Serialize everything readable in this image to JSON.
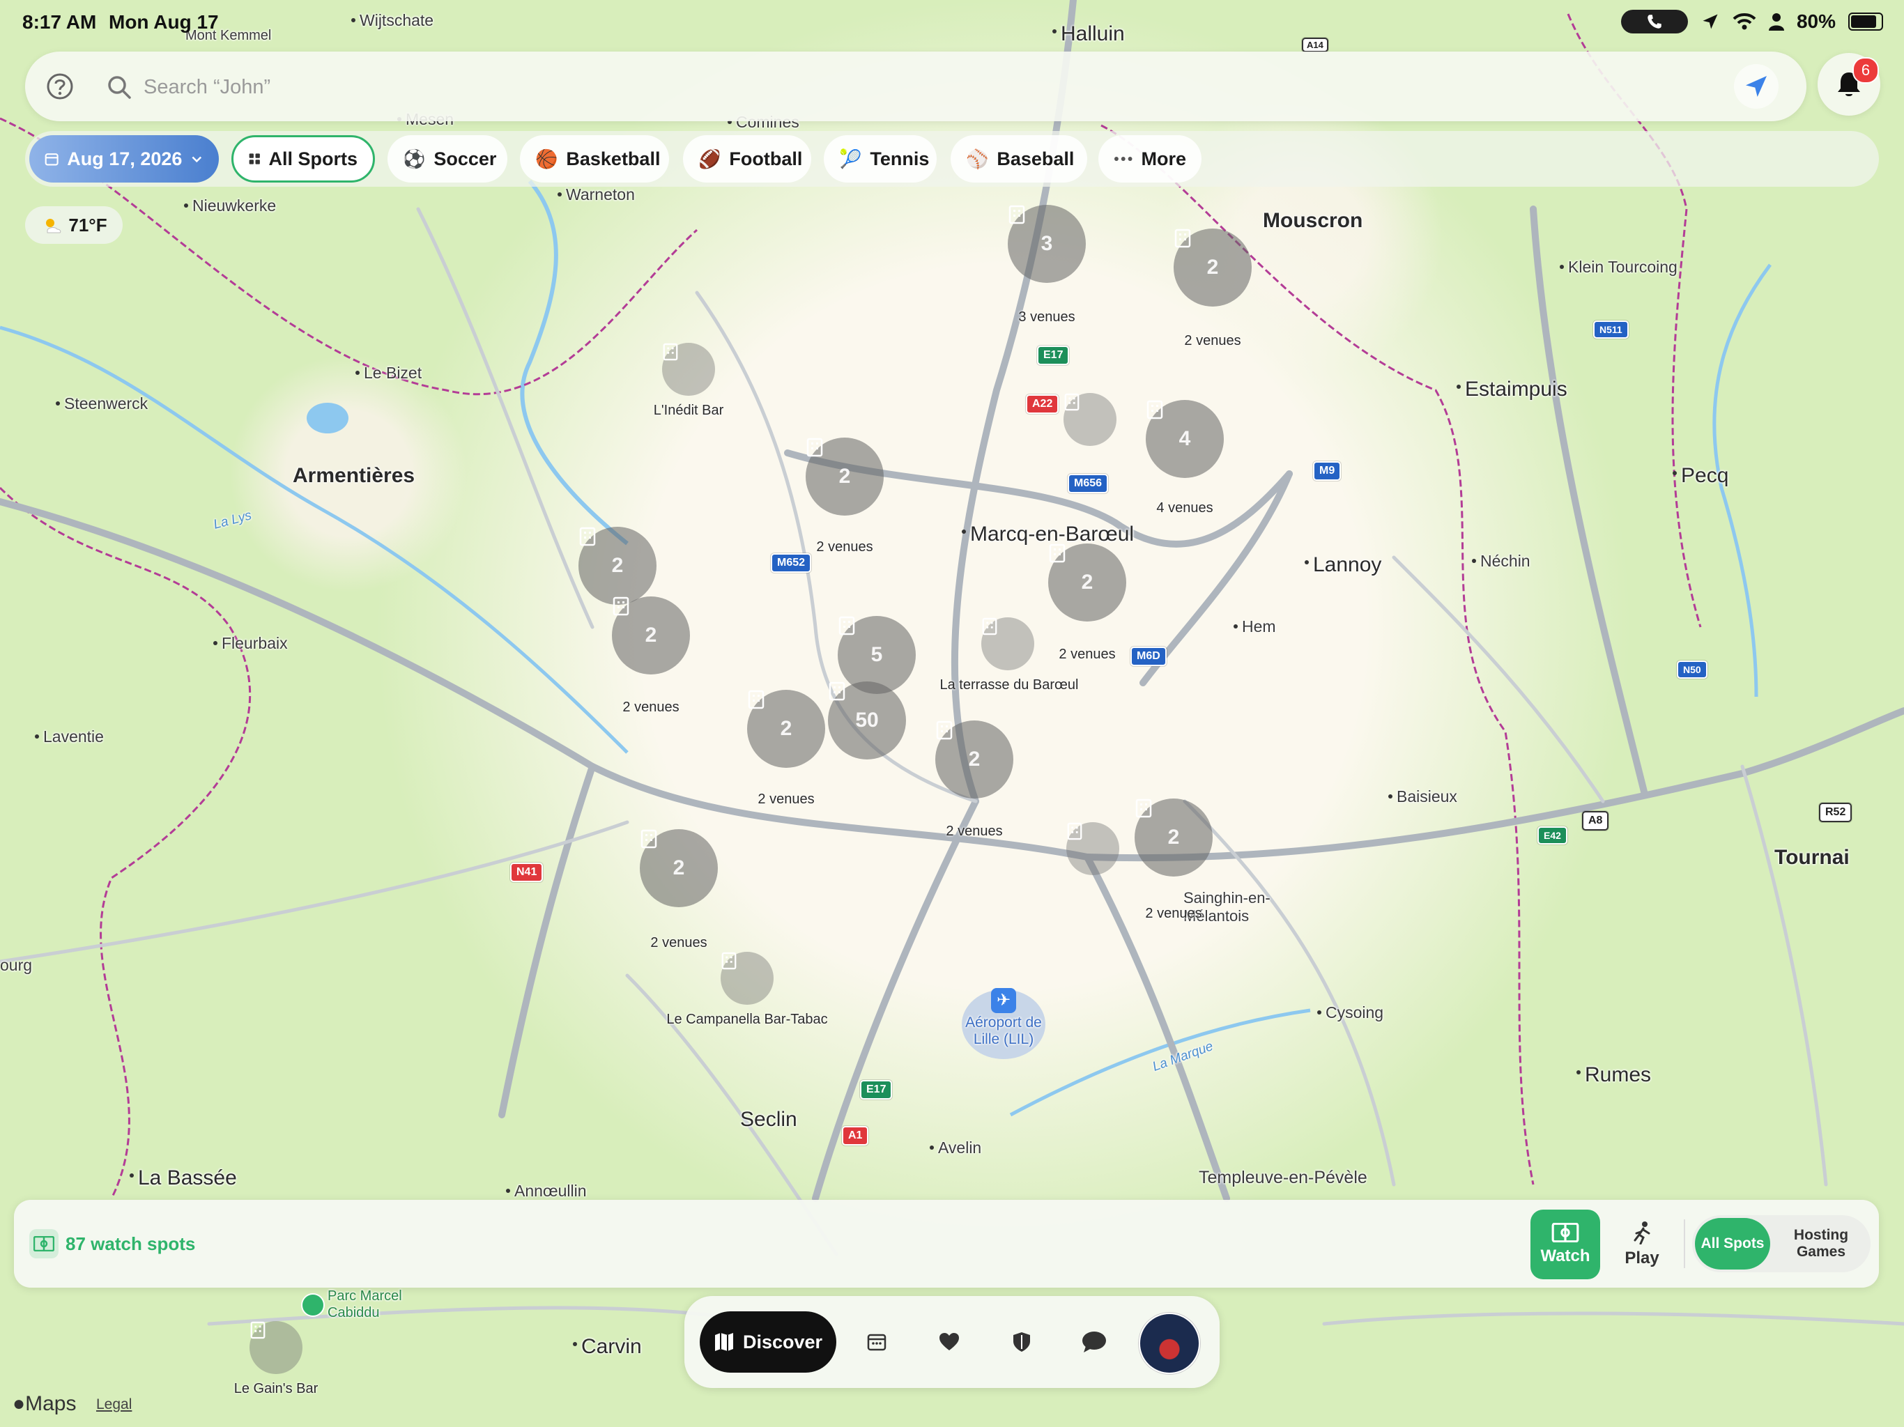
{
  "status_bar": {
    "time": "8:17 AM",
    "date": "Mon Aug 17",
    "battery": "80%"
  },
  "search": {
    "placeholder": "Search “John”"
  },
  "notifications": {
    "count": "6"
  },
  "filters": {
    "date_chip": "Aug 17, 2026",
    "chips": [
      {
        "label": "All Sports",
        "emoji": ""
      },
      {
        "label": "Soccer",
        "emoji": "⚽"
      },
      {
        "label": "Basketball",
        "emoji": "🏀"
      },
      {
        "label": "Football",
        "emoji": "🏈"
      },
      {
        "label": "Tennis",
        "emoji": "🎾"
      },
      {
        "label": "Baseball",
        "emoji": "⚾"
      },
      {
        "label": "More",
        "emoji": ""
      }
    ]
  },
  "weather": {
    "temp": "71°F"
  },
  "map": {
    "places": [
      {
        "name": "Wijtschate"
      },
      {
        "name": "Mont Kemmel"
      },
      {
        "name": "Halluin"
      },
      {
        "name": "Mesen"
      },
      {
        "name": "Comines"
      },
      {
        "name": "Warneton"
      },
      {
        "name": "Nieuwkerke"
      },
      {
        "name": "Mouscron"
      },
      {
        "name": "Klein Tourcoing"
      },
      {
        "name": "Le Bizet"
      },
      {
        "name": "Steenwerck"
      },
      {
        "name": "Armentières"
      },
      {
        "name": "Estaimpuis"
      },
      {
        "name": "Pecq"
      },
      {
        "name": "Marcq-en-Barœul"
      },
      {
        "name": "Lannoy"
      },
      {
        "name": "Néchin"
      },
      {
        "name": "Hem"
      },
      {
        "name": "Fleurbaix"
      },
      {
        "name": "Laventie"
      },
      {
        "name": "Baisieux"
      },
      {
        "name": "Tournai"
      },
      {
        "name": "Sainghin-en-Mélantois"
      },
      {
        "name": "Cysoing"
      },
      {
        "name": "Aéroport de Lille (LIL)"
      },
      {
        "name": "Seclin"
      },
      {
        "name": "Avelin"
      },
      {
        "name": "Rumes"
      },
      {
        "name": "La Bassée"
      },
      {
        "name": "Annœullin"
      },
      {
        "name": "Templeuve-en-Pévèle"
      },
      {
        "name": "Parc Marcel Cabiddu"
      },
      {
        "name": "Carvin"
      },
      {
        "name": "ourg"
      },
      {
        "name": "La Lys"
      },
      {
        "name": "La Marque"
      }
    ],
    "road_shields": [
      "A14",
      "E17",
      "A22",
      "M656",
      "M9",
      "M652",
      "M6D",
      "N511",
      "N50",
      "N41",
      "E42",
      "A8",
      "R52",
      "E17",
      "A1"
    ],
    "clusters": [
      {
        "count": "3",
        "label": "3 venues"
      },
      {
        "count": "2",
        "label": "2 venues"
      },
      {
        "count": "4",
        "label": "4 venues"
      },
      {
        "count": "2",
        "label": "2 venues"
      },
      {
        "count": "2",
        "label": ""
      },
      {
        "count": "2",
        "label": "2 venues"
      },
      {
        "count": "2",
        "label": "2 venues"
      },
      {
        "count": "5",
        "label": ""
      },
      {
        "count": "50",
        "label": ""
      },
      {
        "count": "2",
        "label": "2 venues"
      },
      {
        "count": "2",
        "label": "2 venues"
      },
      {
        "count": "2",
        "label": "2 venues"
      },
      {
        "count": "2",
        "label": "2 venues"
      }
    ],
    "venues": [
      {
        "label": "L'Inédit Bar"
      },
      {
        "label": ""
      },
      {
        "label": "La terrasse du Barœul"
      },
      {
        "label": "Le Campanella Bar-Tabac"
      },
      {
        "label": ""
      },
      {
        "label": "Le Gain's Bar"
      }
    ]
  },
  "bottom_panel": {
    "spots_count": "87 watch spots",
    "watch_label": "Watch",
    "play_label": "Play",
    "all_spots_label": "All Spots",
    "hosting_games_label": "Hosting Games"
  },
  "tabbar": {
    "discover_label": "Discover"
  },
  "attribution": {
    "maps": "Maps",
    "legal": "Legal"
  },
  "colors": {
    "accent": "#2fb46b",
    "notification": "#ec3b3b",
    "date_chip": "#4a7fcf"
  }
}
